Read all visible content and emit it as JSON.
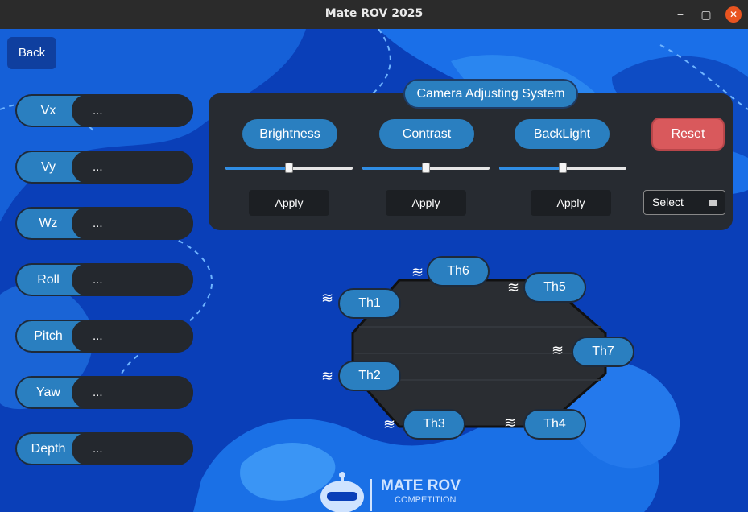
{
  "window": {
    "title": "Mate ROV 2025",
    "minimize": "−",
    "maximize": "▢",
    "close": "✕"
  },
  "back_label": "Back",
  "telemetry": [
    {
      "label": "Vx",
      "value": "..."
    },
    {
      "label": "Vy",
      "value": "..."
    },
    {
      "label": "Wz",
      "value": "..."
    },
    {
      "label": "Roll",
      "value": "..."
    },
    {
      "label": "Pitch",
      "value": "..."
    },
    {
      "label": "Yaw",
      "value": "..."
    },
    {
      "label": "Depth",
      "value": "..."
    }
  ],
  "camera": {
    "title": "Camera Adjusting System",
    "controls": [
      {
        "label": "Brightness",
        "level": 0.5,
        "apply": "Apply"
      },
      {
        "label": "Contrast",
        "level": 0.5,
        "apply": "Apply"
      },
      {
        "label": "BackLight",
        "level": 0.5,
        "apply": "Apply"
      }
    ],
    "reset": "Reset",
    "select": "Select"
  },
  "thrusters": [
    "Th6",
    "Th5",
    "Th1",
    "Th7",
    "Th2",
    "Th3",
    "Th4"
  ],
  "logo": {
    "line1": "MATE ROV",
    "line2": "COMPETITION"
  },
  "colors": {
    "accent": "#2a7fc0",
    "panel": "#272b31",
    "reset": "#d9595c",
    "background": "#0a3fb8"
  }
}
